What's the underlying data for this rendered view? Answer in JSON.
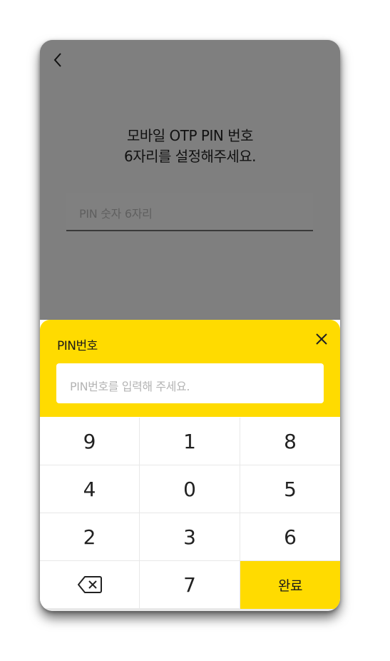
{
  "header": {
    "back_icon": "chevron-left-icon"
  },
  "main": {
    "title_line1": "모바일 OTP PIN 번호",
    "title_line2": "6자리를 설정해주세요.",
    "pin_field_placeholder": "PIN 숫자 6자리"
  },
  "sheet": {
    "title": "PIN번호",
    "close_icon": "close-icon",
    "input_placeholder": "PIN번호를 입력해 주세요.",
    "keys": [
      "9",
      "1",
      "8",
      "4",
      "0",
      "5",
      "2",
      "3",
      "6",
      "backspace",
      "7",
      "완료"
    ],
    "done_label": "완료",
    "backspace_icon": "backspace-icon"
  },
  "colors": {
    "accent": "#ffdb00",
    "overlay": "#7f7f7f"
  }
}
